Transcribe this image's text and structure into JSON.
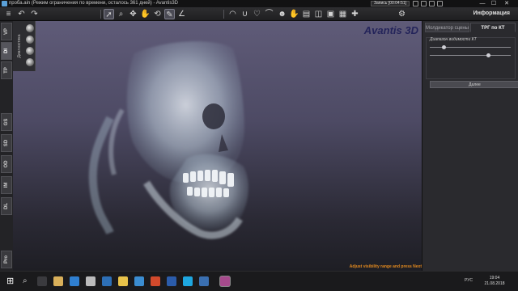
{
  "window": {
    "title": "проба.ain (Режим ограничения по времени, осталось 361 дней) - Avantis3D",
    "recording": "Запись [00:04:51]",
    "controls": {
      "minimize": "—",
      "maximize": "☐",
      "close": "✕"
    }
  },
  "toolbar": {
    "info_title": "Информация",
    "icons": [
      "cursor-icon",
      "hand-icon",
      "rotate-icon",
      "ruler-icon",
      "hand-tool-icon",
      "volume-icon",
      "gear-icon"
    ]
  },
  "left_tabs": [
    "VP",
    "DI",
    "TP",
    "GS",
    "SD",
    "OD",
    "IM",
    "DL",
    "Pro"
  ],
  "side_panel": {
    "label": "Диагностика"
  },
  "viewport": {
    "brand": "Avantis 3D",
    "status_message": "Adjust visibility range and press Next"
  },
  "right_panel": {
    "tabs": [
      {
        "label": "Молдикатор сцены",
        "active": false
      },
      {
        "label": "ТРГ по КТ",
        "active": true
      }
    ],
    "range_label": "Диапазон видимости КТ",
    "slider_low": 0.17,
    "slider_high": 0.72,
    "next_label": "Далее"
  },
  "taskbar": {
    "language": "РУС",
    "time": "19:04",
    "date": "21.08.2018"
  },
  "colors": {
    "accent_orange": "#e38a1f",
    "brand_blue": "#24245a"
  }
}
